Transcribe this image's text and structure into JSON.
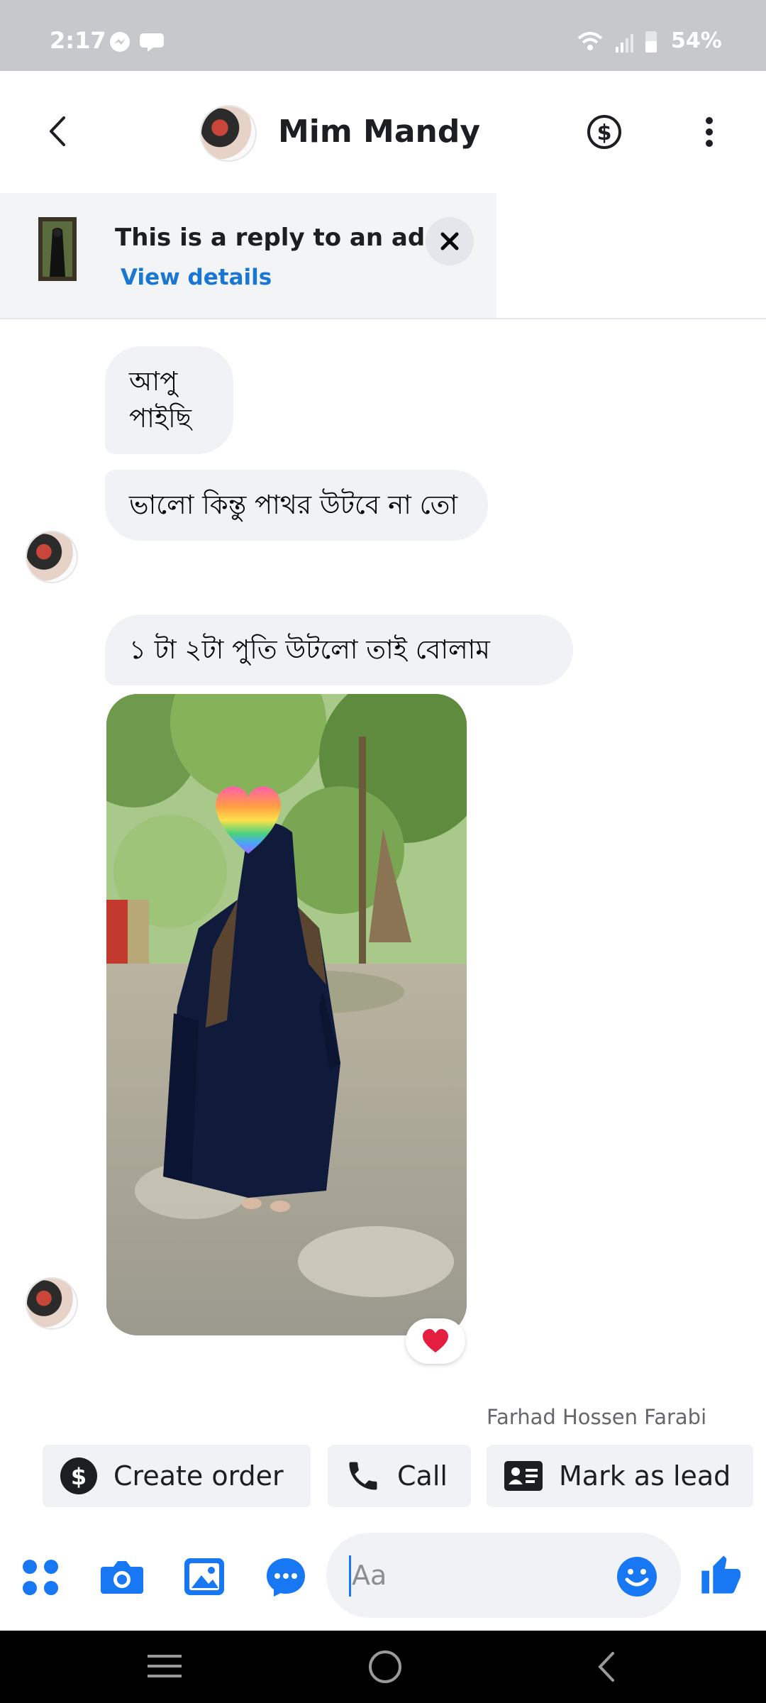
{
  "status_bar": {
    "time": "2:17",
    "battery": "54%"
  },
  "header": {
    "contact_name": "Mim Mandy",
    "back_icon": "chevron-left-icon",
    "payment_icon": "dollar-circle-icon",
    "more_icon": "more-vertical-icon"
  },
  "ad_banner": {
    "title": "This is a reply to an ad",
    "link": "View details",
    "close_icon": "close-icon"
  },
  "messages": [
    {
      "text": "আপু পাইছি"
    },
    {
      "text": "ভালো কিন্তু পাথর উটবে না তো"
    },
    {
      "text": "১ টা ২টা  পুতি উটলো তাই বোলাম"
    }
  ],
  "photo_message": {
    "reaction": "heart"
  },
  "assigned_to": "Farhad Hossen Farabi",
  "actions": {
    "create_order": "Create order",
    "call": "Call",
    "mark_as_lead": "Mark as lead"
  },
  "composer": {
    "placeholder": "Aa"
  },
  "colors": {
    "accent": "#1877f2",
    "bubble": "#f0f2f5",
    "reaction": "#e41e3f"
  }
}
